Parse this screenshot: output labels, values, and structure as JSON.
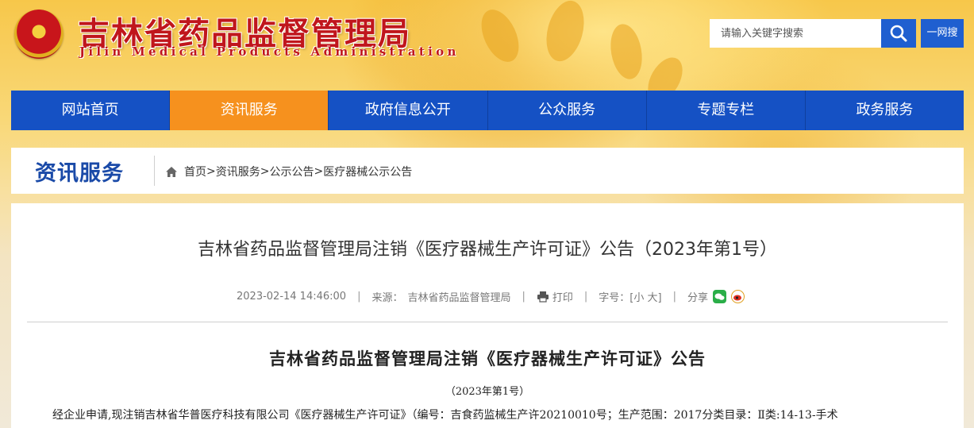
{
  "header": {
    "site_title": "吉林省药品监督管理局",
    "site_subtitle": "Jilin Medical Products Administration",
    "search_placeholder": "请输入关键字搜索",
    "net_button": "一网搜"
  },
  "nav": {
    "items": [
      {
        "label": "网站首页"
      },
      {
        "label": "资讯服务"
      },
      {
        "label": "政府信息公开"
      },
      {
        "label": "公众服务"
      },
      {
        "label": "专题专栏"
      },
      {
        "label": "政务服务"
      }
    ],
    "active": "资讯服务"
  },
  "breadcrumb": {
    "section_title": "资讯服务",
    "items": [
      "首页",
      "资讯服务",
      "公示公告",
      "医疗器械公示公告"
    ],
    "separator": ">"
  },
  "article": {
    "title": "吉林省药品监督管理局注销《医疗器械生产许可证》公告（2023年第1号）",
    "date": "2023-02-14 14:46:00",
    "source_label": "来源：",
    "source": "吉林省药品监督管理局",
    "print_label": "打印",
    "font_size_label": "字号：[小 大]",
    "share_label": "分享",
    "doc_title": "吉林省药品监督管理局注销《医疗器械生产许可证》公告",
    "doc_number": "（2023年第1号）",
    "body_first_line": "经企业申请,现注销吉林省华普医疗科技有限公司《医疗器械生产许可证》（编号：吉食药监械生产许20210010号；生产范围：2017分类目录：Ⅱ类:14-13-手术"
  },
  "colors": {
    "nav_blue": "#1551c4",
    "nav_active": "#f6911e",
    "title_red": "#c0161c",
    "section_blue": "#1a4aa8"
  }
}
